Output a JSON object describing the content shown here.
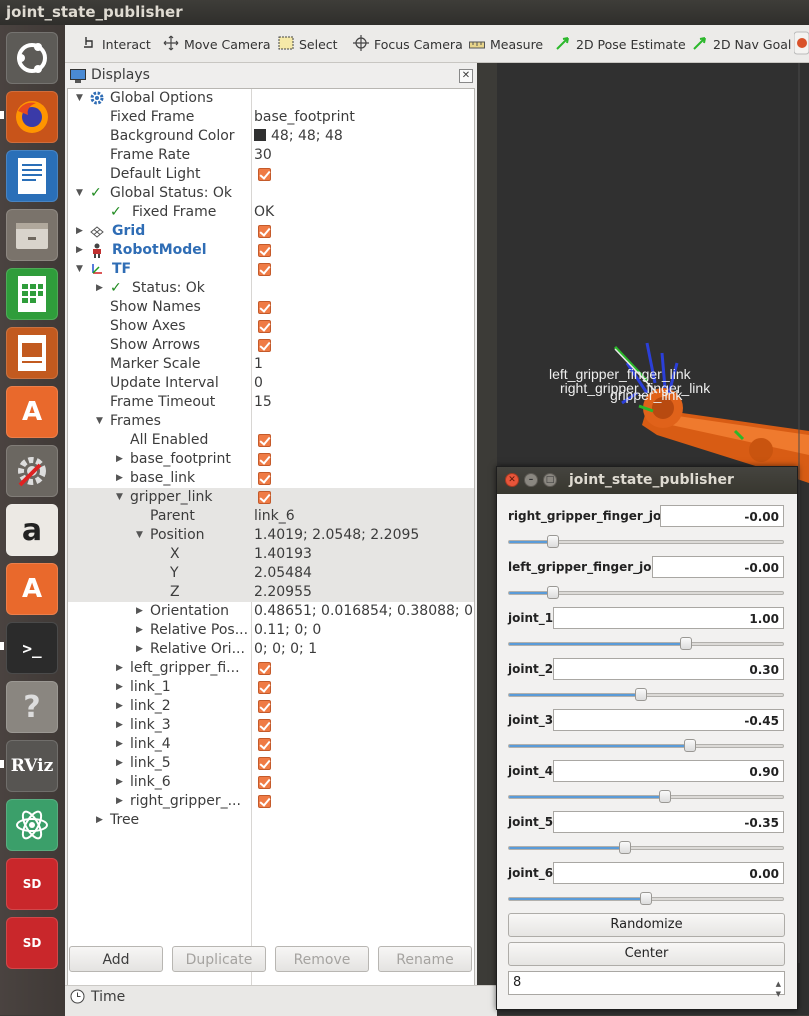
{
  "window_title": "joint_state_publisher",
  "toolbar": {
    "tools": [
      {
        "label": "Interact",
        "icon": "hand-pointer-icon"
      },
      {
        "label": "Move Camera",
        "icon": "move-camera-icon"
      },
      {
        "label": "Select",
        "icon": "select-box-icon"
      },
      {
        "label": "Focus Camera",
        "icon": "focus-target-icon"
      },
      {
        "label": "Measure",
        "icon": "ruler-icon"
      },
      {
        "label": "2D Pose Estimate",
        "icon": "green-arrow-icon"
      },
      {
        "label": "2D Nav Goal",
        "icon": "green-arrow-icon"
      }
    ]
  },
  "launcher": {
    "apps": [
      "ubuntu-dash",
      "firefox",
      "libreoffice-writer",
      "files",
      "libreoffice-calc",
      "libreoffice-impress",
      "ubuntu-software",
      "system-settings",
      "amazon",
      "ubuntu-software-2",
      "terminal",
      "help",
      "rviz",
      "atom",
      "sd-card-1",
      "sd-card-2"
    ],
    "rviz_label": "RViz",
    "help_label": "?",
    "sd_label": "SD"
  },
  "displays": {
    "title": "Displays",
    "rows": [
      {
        "name": "Global Options",
        "value": ""
      },
      {
        "name": "Fixed Frame",
        "value": "base_footprint"
      },
      {
        "name": "Background Color",
        "value": "48; 48; 48"
      },
      {
        "name": "Frame Rate",
        "value": "30"
      },
      {
        "name": "Default Light",
        "value": ""
      },
      {
        "name": "Global Status: Ok",
        "value": ""
      },
      {
        "name": "Fixed Frame",
        "value": "OK"
      },
      {
        "name": "Grid",
        "value": ""
      },
      {
        "name": "RobotModel",
        "value": ""
      },
      {
        "name": "TF",
        "value": ""
      },
      {
        "name": "Status: Ok",
        "value": ""
      },
      {
        "name": "Show Names",
        "value": ""
      },
      {
        "name": "Show Axes",
        "value": ""
      },
      {
        "name": "Show Arrows",
        "value": ""
      },
      {
        "name": "Marker Scale",
        "value": "1"
      },
      {
        "name": "Update Interval",
        "value": "0"
      },
      {
        "name": "Frame Timeout",
        "value": "15"
      },
      {
        "name": "Frames",
        "value": ""
      },
      {
        "name": "All Enabled",
        "value": ""
      },
      {
        "name": "base_footprint",
        "value": ""
      },
      {
        "name": "base_link",
        "value": ""
      },
      {
        "name": "gripper_link",
        "value": ""
      },
      {
        "name": "Parent",
        "value": "link_6"
      },
      {
        "name": "Position",
        "value": "1.4019; 2.0548; 2.2095"
      },
      {
        "name": "X",
        "value": "1.40193"
      },
      {
        "name": "Y",
        "value": "2.05484"
      },
      {
        "name": "Z",
        "value": "2.20955"
      },
      {
        "name": "Orientation",
        "value": "0.48651; 0.016854; 0.38088; 0..."
      },
      {
        "name": "Relative Pos...",
        "value": "0.11; 0; 0"
      },
      {
        "name": "Relative Ori...",
        "value": "0; 0; 0; 1"
      },
      {
        "name": "left_gripper_fi...",
        "value": ""
      },
      {
        "name": "link_1",
        "value": ""
      },
      {
        "name": "link_2",
        "value": ""
      },
      {
        "name": "link_3",
        "value": ""
      },
      {
        "name": "link_4",
        "value": ""
      },
      {
        "name": "link_5",
        "value": ""
      },
      {
        "name": "link_6",
        "value": ""
      },
      {
        "name": "right_gripper_...",
        "value": ""
      },
      {
        "name": "Tree",
        "value": ""
      }
    ],
    "buttons": {
      "add": "Add",
      "duplicate": "Duplicate",
      "remove": "Remove",
      "rename": "Rename"
    }
  },
  "time_panel": {
    "title": "Time"
  },
  "view3d": {
    "labels": {
      "left": "left_gripper_finger_link",
      "right": "right_gripper_finger_link",
      "gripper": "gripper_link"
    },
    "background": "#303030",
    "robot_color": "#e0621a"
  },
  "jsp": {
    "title": "joint_state_publisher",
    "joints": [
      {
        "name": "right_gripper_finger_joint",
        "value": "-0.00",
        "fraction": 0.16
      },
      {
        "name": "left_gripper_finger_joint",
        "value": "-0.00",
        "fraction": 0.16
      },
      {
        "name": "joint_1",
        "value": "1.00",
        "fraction": 0.646
      },
      {
        "name": "joint_2",
        "value": "0.30",
        "fraction": 0.481
      },
      {
        "name": "joint_3",
        "value": "-0.45",
        "fraction": 0.662
      },
      {
        "name": "joint_4",
        "value": "0.90",
        "fraction": 0.57
      },
      {
        "name": "joint_5",
        "value": "-0.35",
        "fraction": 0.422
      },
      {
        "name": "joint_6",
        "value": "0.00",
        "fraction": 0.5
      }
    ],
    "randomize_label": "Randomize",
    "center_label": "Center",
    "spin_value": "8",
    "accent_color": "#5a9bd8"
  }
}
